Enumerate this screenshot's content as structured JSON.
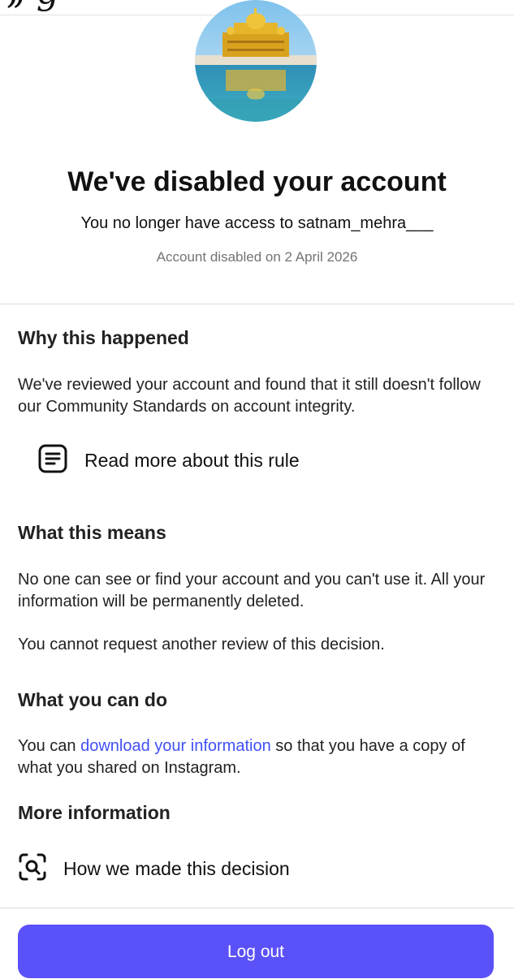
{
  "header": {
    "logo_fragment": "„ g"
  },
  "profile": {
    "title": "We've disabled your account",
    "subtitle": "You no longer have access to satnam_mehra___",
    "disabled_date": "Account disabled on 2 April 2026"
  },
  "why": {
    "heading": "Why this happened",
    "body": "We've reviewed your account and found that it still doesn't follow our Community Standards on account integrity.",
    "rule_link": "Read more about this rule"
  },
  "means": {
    "heading": "What this means",
    "body1": "No one can see or find your account and you can't use it. All your information will be permanently deleted.",
    "body2": "You cannot request another review of this decision."
  },
  "cando": {
    "heading": "What you can do",
    "prefix": "You can ",
    "link": "download your information",
    "suffix": " so that you have a copy of what you shared on Instagram."
  },
  "more": {
    "heading": "More information",
    "decision_link": "How we made this decision"
  },
  "footer": {
    "logout_label": "Log out"
  },
  "icons": {
    "rule": "document-lines-icon",
    "decision": "search-scan-icon"
  },
  "colors": {
    "button": "#5b51f8",
    "link": "#4150f7",
    "muted": "#737373"
  }
}
